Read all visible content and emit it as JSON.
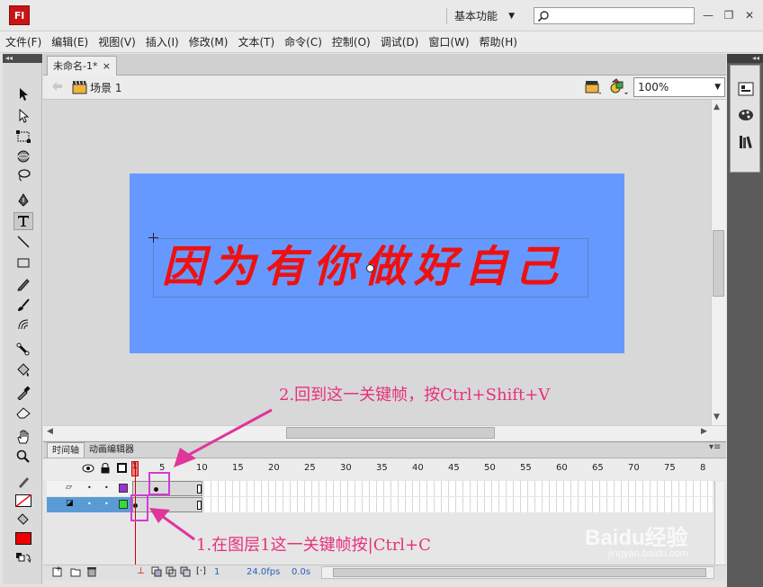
{
  "app": {
    "logo": "Fl",
    "workspace": "基本功能",
    "search_placeholder": ""
  },
  "window_buttons": {
    "minimize": "—",
    "restore": "❐",
    "close": "✕"
  },
  "menu": [
    "文件(F)",
    "编辑(E)",
    "视图(V)",
    "插入(I)",
    "修改(M)",
    "文本(T)",
    "命令(C)",
    "控制(O)",
    "调试(D)",
    "窗口(W)",
    "帮助(H)"
  ],
  "document": {
    "tab_label": "未命名-1*",
    "close_glyph": "×",
    "scene_label": "场景 1",
    "zoom": "100%"
  },
  "stage": {
    "text": "因为有你做好自己",
    "text_color": "#ee1111",
    "background_color": "#6699ff"
  },
  "panel_collapse": "◂◂",
  "timeline": {
    "tabs": [
      "时间轴",
      "动画编辑器"
    ],
    "frame_numbers": [
      "1",
      "5",
      "10",
      "15",
      "20",
      "25",
      "30",
      "35",
      "40",
      "45",
      "50",
      "55",
      "60",
      "65",
      "70",
      "75",
      "8"
    ],
    "layers": [
      {
        "color": "#9933cc",
        "selected": false
      },
      {
        "color": "#33dd33",
        "selected": true
      }
    ],
    "footer": {
      "current_frame": "1",
      "fps": "24.0",
      "fps_unit": "fps",
      "time": "0.0s"
    }
  },
  "annotations": {
    "step2": "2.回到这一关键帧，按Ctrl+Shift+V",
    "step1": "1.在图层1这一关键帧按|Ctrl+C",
    "watermark_brand": "Baidu经验",
    "watermark_url": "jingyan.baidu.com",
    "color": "#e8307a"
  }
}
